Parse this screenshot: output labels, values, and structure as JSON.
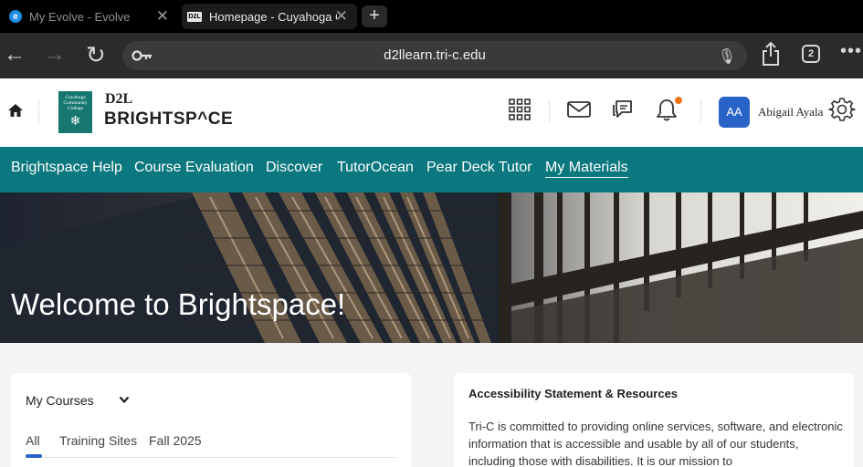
{
  "browser": {
    "tabs": [
      {
        "title": "My Evolve - Evolve",
        "favicon": "e"
      },
      {
        "title": "Homepage - Cuyahoga C",
        "favicon": "D2L"
      }
    ],
    "close_glyph": "✕",
    "add_glyph": "+",
    "url": "d2llearn.tri-c.edu",
    "tab_count": "2"
  },
  "header": {
    "logo_lines": [
      "Cuyahoga",
      "Community",
      "College"
    ],
    "d2l": "D2L",
    "brightspace": "BRIGHTSP^CE",
    "user_initials": "AA",
    "user_name": "Abigail Ayala"
  },
  "nav": {
    "items": [
      {
        "label": "Brightspace Help"
      },
      {
        "label": "Course Evaluation"
      },
      {
        "label": "Discover"
      },
      {
        "label": "TutorOcean"
      },
      {
        "label": "Pear Deck Tutor"
      },
      {
        "label": "My Materials",
        "active": true
      }
    ]
  },
  "hero": {
    "title": "Welcome to Brightspace!"
  },
  "my_courses": {
    "title": "My Courses",
    "tabs": [
      "All",
      "Training Sites",
      "Fall 2025"
    ],
    "selected_tab": "All"
  },
  "accessibility": {
    "title": "Accessibility Statement & Resources",
    "body": "Tri-C is committed to providing online services, software, and electronic information that is accessible and usable by all of our students, including those with disabilities. It is our mission to"
  },
  "colors": {
    "teal": "#0b777e",
    "avatar": "#2a63c7",
    "notification": "#e87511"
  },
  "icons": {
    "home": "home-icon",
    "apps": "grid-icon",
    "mail": "envelope-icon",
    "chat": "chat-icon",
    "alerts": "bell-icon",
    "settings": "gear-icon"
  }
}
